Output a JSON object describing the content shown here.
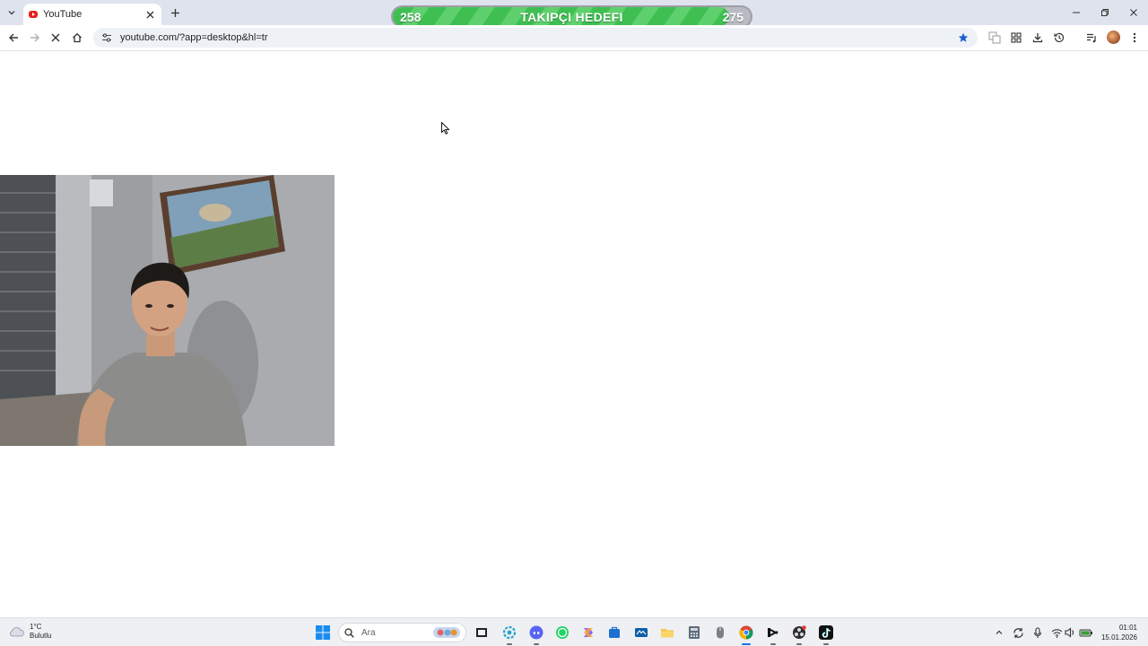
{
  "browser": {
    "tab": {
      "title": "YouTube"
    },
    "url": "youtube.com/?app=desktop&hl=tr"
  },
  "goal_overlay": {
    "title": "TAKIPÇI HEDEFI",
    "current": "258",
    "target": "275",
    "progress_fraction": 0.94,
    "colors": {
      "fill": "#3fbf52",
      "track": "#b8bcc2"
    }
  },
  "taskbar": {
    "weather": {
      "temperature": "1°C",
      "condition": "Bulutlu"
    },
    "search_placeholder": "Ara",
    "clock": {
      "time": "01:01",
      "date": "15.01.2026"
    },
    "apps": [
      "windows-start-icon",
      "search-icon",
      "file-explorer-icon",
      "settings-icon",
      "discord-icon",
      "whatsapp-icon",
      "copilot-icon",
      "store-icon",
      "news-icon",
      "folder-icon",
      "calculator-icon",
      "mouse-app-icon",
      "chrome-icon",
      "capcut-icon",
      "obs-icon",
      "tiktok-icon"
    ]
  }
}
